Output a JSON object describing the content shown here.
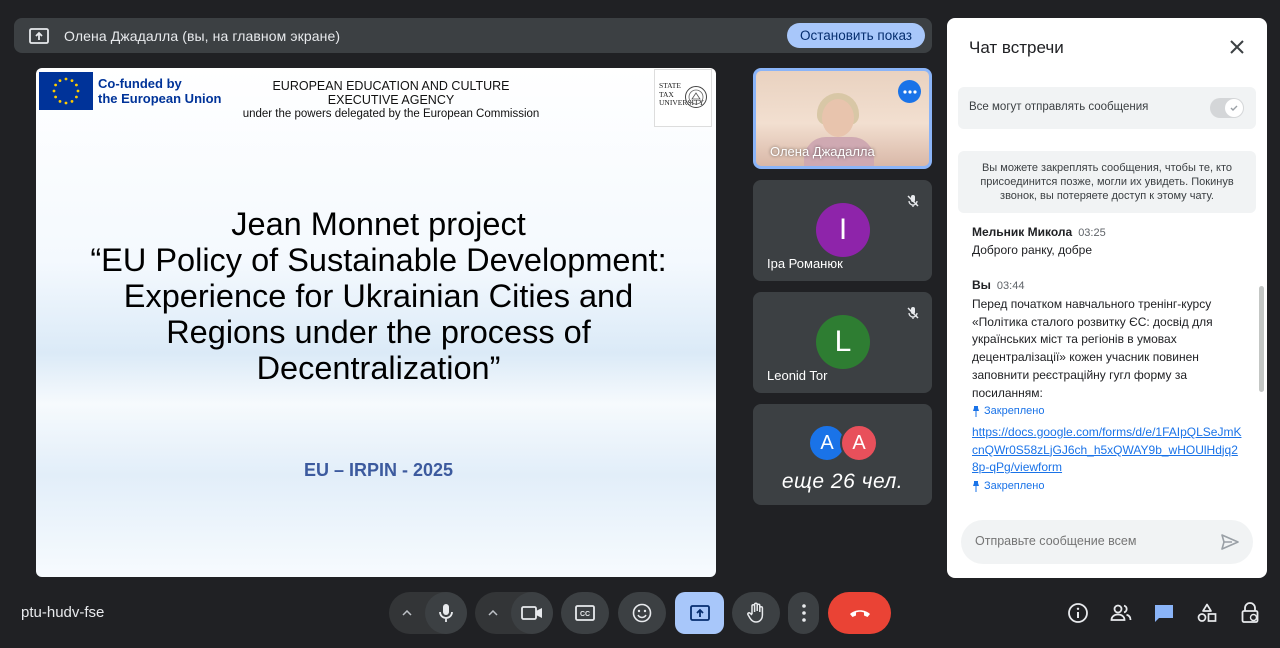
{
  "banner": {
    "text": "Олена Джадалла (вы, на главном экране)",
    "stop_label": "Остановить показ"
  },
  "slide": {
    "cofunded_line1": "Co-funded by",
    "cofunded_line2": "the European Union",
    "agency_line1": "EUROPEAN EDUCATION AND CULTURE EXECUTIVE AGENCY",
    "agency_line2": "under the powers delegated by the European Commission",
    "university_line1": "STATE",
    "university_line2": "TAX",
    "university_line3": "UNIVERSITY",
    "title_line1": "Jean Monnet project",
    "title_line2": "“EU Policy of Sustainable Development:",
    "title_line3": "Experience for Ukrainian Cities and",
    "title_line4": "Regions under the process of",
    "title_line5": "Decentralization”",
    "footer": "EU – IRPIN - 2025"
  },
  "participants": [
    {
      "name": "Олена Джадалла",
      "video": true,
      "pinned_presenter": true
    },
    {
      "name": "Іра Романюк",
      "initial": "І",
      "color": "#8e24aa",
      "muted": true
    },
    {
      "name": "Leonid Tor",
      "initial": "L",
      "color": "#2e7d32",
      "muted": true
    }
  ],
  "more_tile": {
    "avatars": [
      {
        "initial": "A",
        "color": "#1a73e8"
      },
      {
        "initial": "A",
        "color": "#e8505b"
      }
    ],
    "label": "еще 26 чел."
  },
  "chat": {
    "title": "Чат встречи",
    "allow_label": "Все могут отправлять сообщения",
    "allow_enabled": true,
    "info_text": "Вы можете закреплять сообщения, чтобы те, кто присоединится позже, могли их увидеть. Покинув звонок, вы потеряете доступ к этому чату.",
    "messages": [
      {
        "sender": "Мельник Микола",
        "time": "03:25",
        "text": "Доброго ранку, добре"
      },
      {
        "sender": "Вы",
        "time": "03:44",
        "text": "Перед початком навчального тренінг-курсу «Політика сталого розвитку ЄС: досвід для українських міст та регіонів в умовах децентралізації» кожен учасник повинен заповнити реєстраційну гугл форму за посиланням:",
        "pinned_label": "Закреплено",
        "link": "https://docs.google.com/forms/d/e/1FAIpQLSeJmKcnQWr0S58zLjGJ6ch_h5xQWAY9b_wHOUlHdjq28p-qPg/viewform",
        "link_pinned_label": "Закреплено"
      }
    ],
    "send_placeholder": "Отправьте сообщение всем"
  },
  "meeting_code": "ptu-hudv-fse",
  "colors": {
    "background": "#202124",
    "accent": "#a8c7fa",
    "end_call": "#ea4335",
    "link": "#1a73e8"
  },
  "controls": [
    "mic-icon",
    "camera-icon",
    "captions-icon",
    "emoji-icon",
    "present-icon",
    "raise-hand-icon",
    "more-options-icon",
    "end-call-icon"
  ],
  "right_controls": [
    "info-icon",
    "people-icon",
    "chat-icon",
    "activities-icon",
    "host-controls-icon"
  ]
}
